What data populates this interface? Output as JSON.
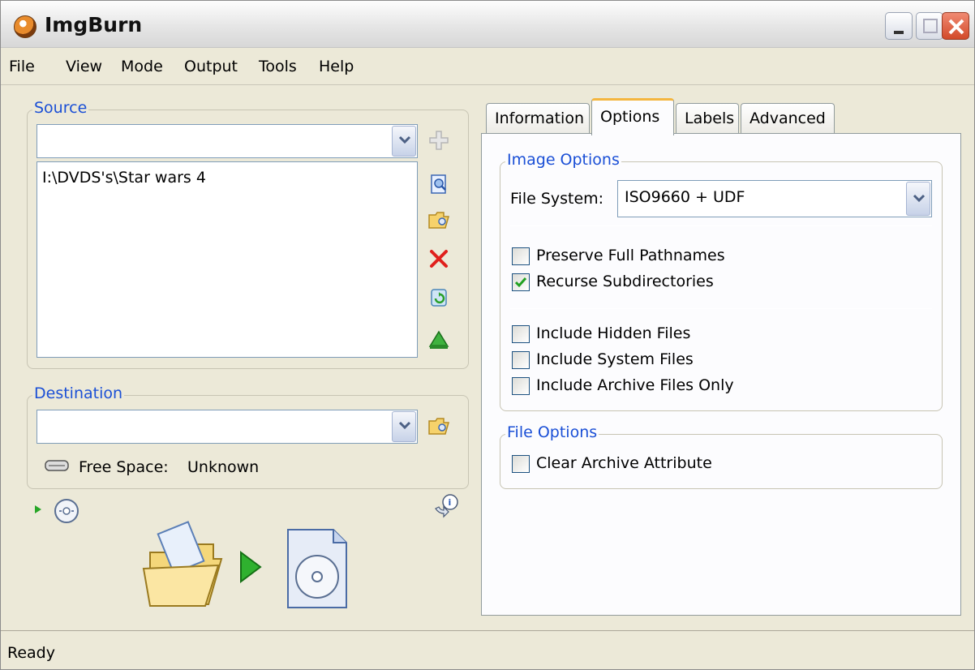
{
  "window": {
    "title": "ImgBurn"
  },
  "menu": {
    "items": [
      "File",
      "View",
      "Mode",
      "Output",
      "Tools",
      "Help"
    ]
  },
  "source": {
    "label": "Source",
    "combo_value": "",
    "list_items": [
      "I:\\DVDS's\\Star wars 4"
    ]
  },
  "destination": {
    "label": "Destination",
    "combo_value": "",
    "free_space_label": "Free Space:",
    "free_space_value": "Unknown"
  },
  "tabs": [
    "Information",
    "Options",
    "Labels",
    "Advanced"
  ],
  "active_tab": "Options",
  "image_options": {
    "label": "Image Options",
    "file_system_label": "File System:",
    "file_system_value": "ISO9660 + UDF",
    "checkboxes": [
      {
        "label": "Preserve Full Pathnames",
        "checked": false
      },
      {
        "label": "Recurse Subdirectories",
        "checked": true
      },
      {
        "label": "Include Hidden Files",
        "checked": false
      },
      {
        "label": "Include System Files",
        "checked": false
      },
      {
        "label": "Include Archive Files Only",
        "checked": false
      }
    ]
  },
  "file_options": {
    "label": "File Options",
    "checkboxes": [
      {
        "label": "Clear Archive Attribute",
        "checked": false
      }
    ]
  },
  "status": {
    "text": "Ready"
  },
  "colors": {
    "group_label": "#1a4fd6",
    "window_bg": "#ece9d8",
    "tab_highlight": "#f4b63f",
    "check_green": "#21a121",
    "delete_red": "#e0201c"
  },
  "icons": {
    "add": "plus-icon",
    "browse_file": "browse-file-icon",
    "browse_folder": "browse-folder-icon",
    "remove": "delete-icon",
    "refresh": "refresh-icon",
    "calculate": "calculate-icon",
    "drive": "drive-icon",
    "disc": "disc-icon",
    "info": "info-icon",
    "build": "build-icon"
  }
}
